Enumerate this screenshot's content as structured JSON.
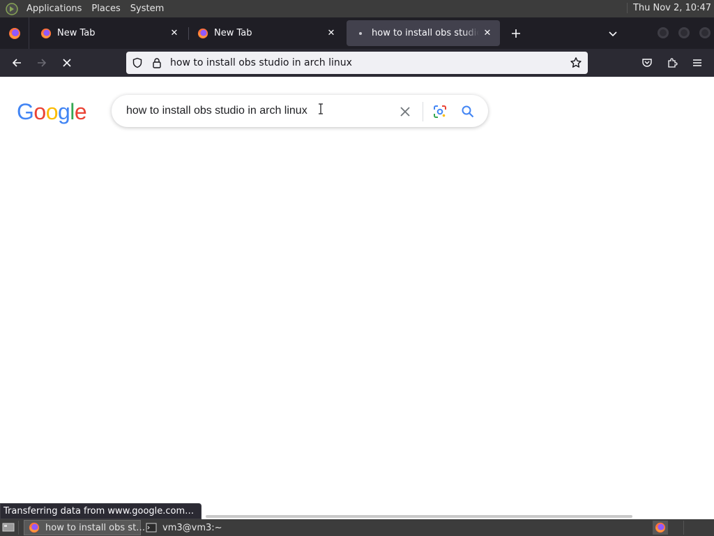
{
  "top_panel": {
    "menus": [
      "Applications",
      "Places",
      "System"
    ],
    "clock": "Thu Nov  2, 10:47"
  },
  "tabs": [
    {
      "label": "New Tab",
      "active": false
    },
    {
      "label": "New Tab",
      "active": false
    },
    {
      "label": "how to install obs studio in arch linux",
      "active": true
    }
  ],
  "toolbar": {
    "url": "how to install obs studio in arch linux"
  },
  "page": {
    "logo_letters": [
      "G",
      "o",
      "o",
      "g",
      "l",
      "e"
    ],
    "logo_colors": [
      "#4285f4",
      "#ea4335",
      "#fbbc05",
      "#4285f4",
      "#34a853",
      "#ea4335"
    ],
    "search_query": "how to install obs studio in arch linux"
  },
  "status_bar": {
    "text": "Transferring data from www.google.com…"
  },
  "taskbar": {
    "tasks": [
      {
        "label": "how to install obs st…",
        "icon": "firefox-icon",
        "active": true
      },
      {
        "label": "vm3@vm3:~",
        "icon": "terminal-icon",
        "active": false
      }
    ]
  },
  "colors": {
    "panel": "#3c3c3c",
    "tab_strip": "#1f1e25",
    "active_tab": "#42414d",
    "toolbar": "#2b2a33",
    "url_field": "#f0f0f4",
    "google_blue": "#4285f4"
  }
}
